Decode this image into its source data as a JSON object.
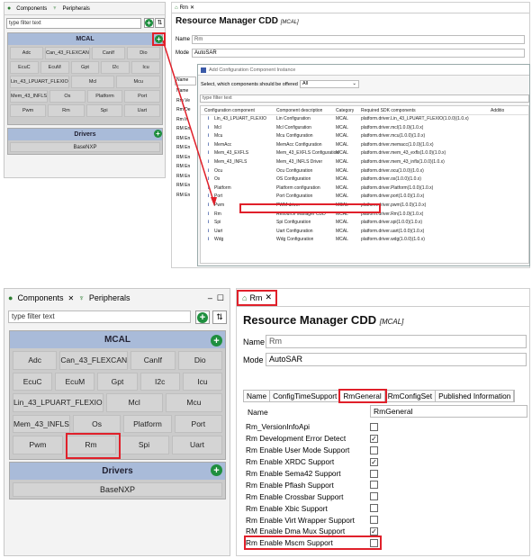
{
  "top": {
    "components_tab": "Components",
    "peripherals_tab": "Peripherals",
    "filter_placeholder": "type filter text",
    "mcal_title": "MCAL",
    "drivers_title": "Drivers",
    "mcal_rows": [
      [
        "Adc",
        "Can_43_FLEXCAN",
        "CanIf",
        "Dio"
      ],
      [
        "EcuC",
        "EcuM",
        "Gpt",
        "I2c",
        "Icu"
      ],
      [
        "Lin_43_LPUART_FLEXIO",
        "Mcl",
        "Mcu"
      ],
      [
        "Mem_43_INFLS",
        "Os",
        "Platform",
        "Port"
      ],
      [
        "Pwm",
        "Rm",
        "Spi",
        "Uart"
      ]
    ],
    "driver_item": "BaseNXP",
    "editor_tab": "Rm",
    "editor_title": "Resource Manager CDD",
    "editor_subtitle": "[MCAL]",
    "name_label": "Name",
    "name_value": "Rm",
    "mode_label": "Mode",
    "mode_value": "AutoSAR",
    "bg_column_header": "Name",
    "bg_left_labels": [
      "Name",
      "Rm Ve",
      "Rm De",
      "Rm In",
      "RM En",
      "RM En",
      "RM En",
      "RM En",
      "RM En",
      "RM En",
      "RM En",
      "RM En"
    ],
    "dialog": {
      "title": "Add Configuration Component Instance",
      "select_label": "Select, which components should be offered",
      "select_value": "All",
      "filter_placeholder": "type filter text",
      "headers": [
        "Configuration component",
        "Component description",
        "Category",
        "Required SDK components",
        "Additio"
      ],
      "rows": [
        [
          "Lin_43_LPUART_FLEXIO",
          "Lin Configuration",
          "MCAL",
          "platform.driver.Lin_43_LPUART_FLEXIO(1.0.0)(1.0.x)"
        ],
        [
          "Mcl",
          "Mcl Configuration",
          "MCAL",
          "platform.driver.mcl(1.0.0)(1.0.x)"
        ],
        [
          "Mcu",
          "Mcu Configuration",
          "MCAL",
          "platform.driver.mcu(1.0.0)(1.0.x)"
        ],
        [
          "MemAcc",
          "MemAcc Configuration",
          "MCAL",
          "platform.driver.memacc(1.0.0)(1.0.x)"
        ],
        [
          "Mem_43_EXFLS",
          "Mem_43_EXFLS Configuration",
          "MCAL",
          "platform.driver.mem_43_exfls(1.0.0)(1.0.x)"
        ],
        [
          "Mem_43_INFLS",
          "Mem_43_INFLS Driver",
          "MCAL",
          "platform.driver.mem_43_infls(1.0.0)(1.0.x)"
        ],
        [
          "Ocu",
          "Ocu Configuration",
          "MCAL",
          "platform.driver.ocu(1.0.0)(1.0.x)"
        ],
        [
          "Os",
          "OS Configuration",
          "MCAL",
          "platform.driver.os(1.0.0)(1.0.x)"
        ],
        [
          "Platform",
          "Platform configuration",
          "MCAL",
          "platform.driver.Platform(1.0.0)(1.0.x)"
        ],
        [
          "Port",
          "Port Configuration",
          "MCAL",
          "platform.driver.port(1.0.0)(1.0.x)"
        ],
        [
          "Pwm",
          "PWM driver",
          "MCAL",
          "platform.driver.pwm(1.0.0)(1.0.x)"
        ],
        [
          "Rm",
          "Resource Manager CDD",
          "MCAL",
          "platform.driver.Rm(1.0.0)(1.0.x)"
        ],
        [
          "Spi",
          "Spi Configuration",
          "MCAL",
          "platform.driver.spi(1.0.0)(1.0.x)"
        ],
        [
          "Uart",
          "Uart Configuration",
          "MCAL",
          "platform.driver.uart(1.0.0)(1.0.x)"
        ],
        [
          "Wdg",
          "Wdg Configuration",
          "MCAL",
          "platform.driver.wdg(1.0.0)(1.0.x)"
        ]
      ]
    }
  },
  "bottom": {
    "components_tab": "Components",
    "peripherals_tab": "Peripherals",
    "filter_placeholder": "type filter text",
    "mcal_title": "MCAL",
    "drivers_title": "Drivers",
    "mcal_rows": [
      [
        "Adc",
        "Can_43_FLEXCAN",
        "CanIf",
        "Dio"
      ],
      [
        "EcuC",
        "EcuM",
        "Gpt",
        "I2c",
        "Icu"
      ],
      [
        "Lin_43_LPUART_FLEXIO",
        "Mcl",
        "Mcu"
      ],
      [
        "Mem_43_INFLS",
        "Os",
        "Platform",
        "Port"
      ],
      [
        "Pwm",
        "Rm",
        "Spi",
        "Uart"
      ]
    ],
    "driver_item": "BaseNXP",
    "editor_tab": "Rm",
    "editor_title": "Resource Manager CDD",
    "editor_subtitle": "[MCAL]",
    "name_label": "Name",
    "name_value": "Rm",
    "mode_label": "Mode",
    "mode_value": "AutoSAR",
    "tabs": [
      "Name",
      "ConfigTimeSupport",
      "RmGeneral",
      "RmConfigSet",
      "Published Information"
    ],
    "prop_header": "Name",
    "prop_header_value": "RmGeneral",
    "props": [
      {
        "label": "Rm_VersionInfoApi",
        "checked": false
      },
      {
        "label": "Rm Development Error Detect",
        "checked": true
      },
      {
        "label": "Rm Enable User Mode Support",
        "checked": false
      },
      {
        "label": "Rm Enable XRDC Support",
        "checked": true
      },
      {
        "label": "Rm Enable Sema42 Support",
        "checked": false
      },
      {
        "label": "Rm Enable Pflash Support",
        "checked": false
      },
      {
        "label": "Rm Enable Crossbar Support",
        "checked": false
      },
      {
        "label": "Rm Enable Xbic Support",
        "checked": false
      },
      {
        "label": "Rm Enable Virt Wrapper Support",
        "checked": false
      },
      {
        "label": "RM Enable Dma Mux Support",
        "checked": true
      },
      {
        "label": "Rm Enable Mscm Support",
        "checked": false
      }
    ],
    "check_mark": "✓"
  }
}
